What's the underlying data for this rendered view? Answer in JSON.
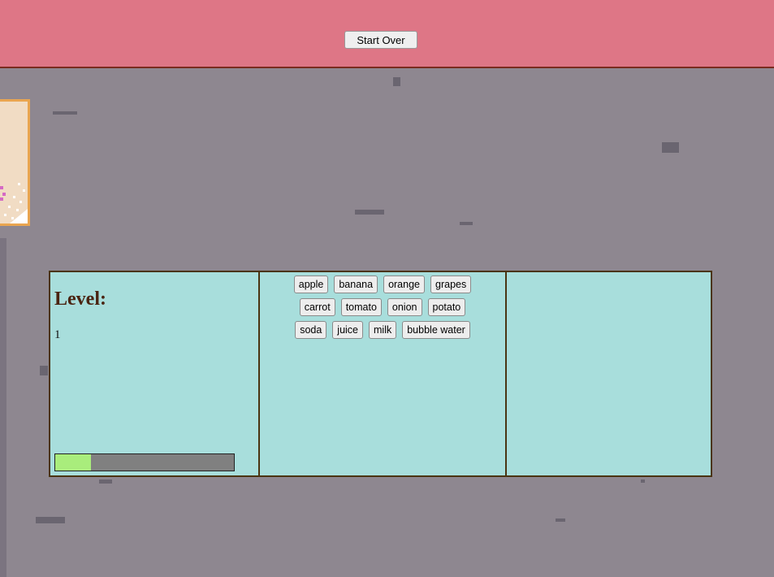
{
  "header": {
    "start_over_label": "Start Over",
    "color": "#de7686"
  },
  "level": {
    "label": "Level:",
    "value": "1",
    "progress_fraction": 0.2
  },
  "words": [
    [
      "apple",
      "banana",
      "orange",
      "grapes"
    ],
    [
      "carrot",
      "tomato",
      "onion",
      "potato"
    ],
    [
      "soda",
      "juice",
      "milk",
      "bubble water"
    ]
  ],
  "colors": {
    "background": "#8e8790",
    "panel": "#a8dedc",
    "panel_border": "#4a3412",
    "progress_fill": "#a9ed7c",
    "progress_track": "#808080"
  }
}
